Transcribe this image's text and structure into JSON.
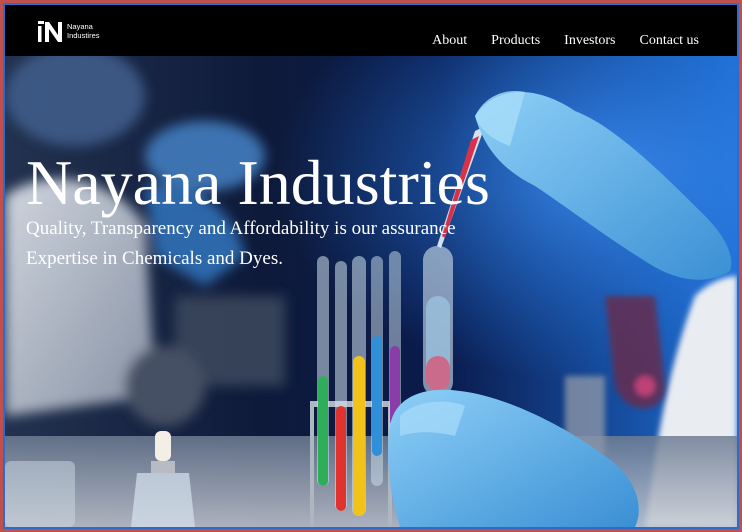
{
  "brand": {
    "line1": "Nayana",
    "line2": "Industires"
  },
  "nav": [
    {
      "label": "About"
    },
    {
      "label": "Products"
    },
    {
      "label": "Investors"
    },
    {
      "label": "Contact us"
    }
  ],
  "hero": {
    "title": "Nayana Industries",
    "tagline": "Quality, Transparency and Affordability is our assurance",
    "subline": "Expertise in Chemicals and Dyes."
  },
  "colors": {
    "navbar": "#000000",
    "outer_border": "#c0504d",
    "inner_border": "#2d6cc9",
    "glove": "#4fa8e8"
  }
}
